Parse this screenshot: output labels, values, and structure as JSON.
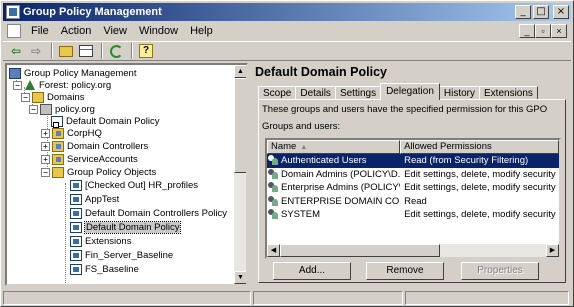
{
  "window": {
    "title": "Group Policy Management"
  },
  "menu": {
    "items": [
      {
        "label": "File"
      },
      {
        "label": "Action"
      },
      {
        "label": "View"
      },
      {
        "label": "Window"
      },
      {
        "label": "Help"
      }
    ]
  },
  "tree": {
    "items": [
      {
        "label": "Group Policy Management"
      },
      {
        "label": "Forest: policy.org"
      },
      {
        "label": "Domains"
      },
      {
        "label": "policy.org"
      },
      {
        "label": "Default Domain Policy"
      },
      {
        "label": "CorpHQ"
      },
      {
        "label": "Domain Controllers"
      },
      {
        "label": "ServiceAccounts"
      },
      {
        "label": "Group Policy Objects"
      },
      {
        "label": "[Checked Out] HR_profiles"
      },
      {
        "label": "AppTest"
      },
      {
        "label": "Default Domain Controllers Policy"
      },
      {
        "label": "Default Domain Policy"
      },
      {
        "label": "Extensions"
      },
      {
        "label": "Fin_Server_Baseline"
      },
      {
        "label": "FS_Baseline"
      }
    ],
    "selected_index": 12
  },
  "details": {
    "title": "Default Domain Policy",
    "tabs": [
      {
        "label": "Scope"
      },
      {
        "label": "Details"
      },
      {
        "label": "Settings"
      },
      {
        "label": "Delegation"
      },
      {
        "label": "History"
      },
      {
        "label": "Extensions"
      }
    ],
    "active_tab": "Delegation",
    "description": "These groups and users have the specified permission for this GPO",
    "groups_label": "Groups and users:",
    "columns": {
      "name": "Name",
      "permissions": "Allowed Permissions"
    },
    "rows": [
      {
        "name": "Authenticated Users",
        "permission": "Read (from Security Filtering)",
        "selected": true
      },
      {
        "name": "Domain Admins (POLICY\\D...",
        "permission": "Edit settings, delete, modify security"
      },
      {
        "name": "Enterprise Admins (POLICY\\...",
        "permission": "Edit settings, delete, modify security"
      },
      {
        "name": "ENTERPRISE DOMAIN CO...",
        "permission": "Read"
      },
      {
        "name": "SYSTEM",
        "permission": "Edit settings, delete, modify security"
      }
    ],
    "buttons": {
      "add": "Add...",
      "remove": "Remove",
      "properties": "Properties"
    }
  }
}
